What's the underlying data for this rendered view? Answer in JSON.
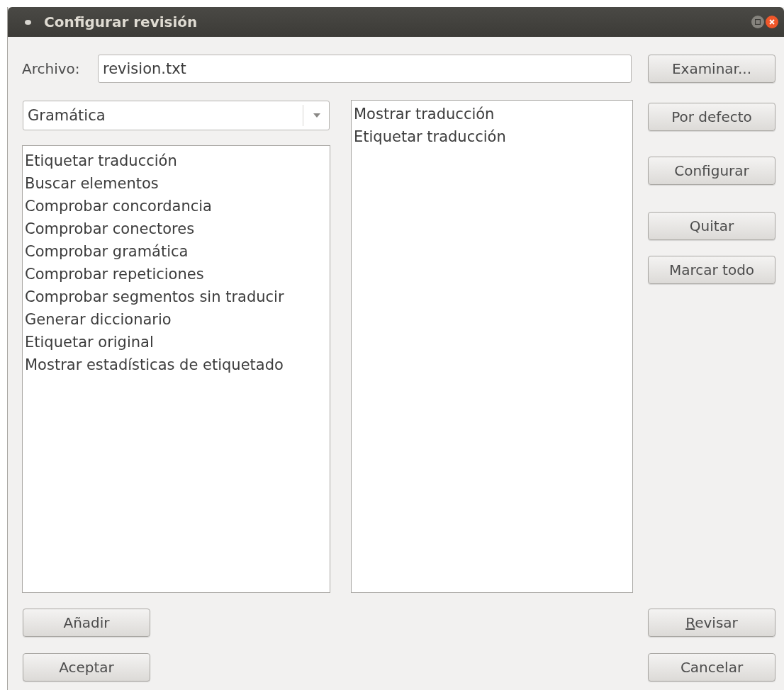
{
  "window": {
    "title": "Configurar revisión"
  },
  "file": {
    "label": "Archivo:",
    "value": "revision.txt",
    "button": "Examinar..."
  },
  "category": {
    "value": "Gramática"
  },
  "available": [
    "Etiquetar traducción",
    "Buscar elementos",
    "Comprobar concordancia",
    "Comprobar conectores",
    "Comprobar gramática",
    "Comprobar repeticiones",
    "Comprobar segmentos sin traducir",
    "Generar diccionario",
    "Etiquetar original",
    "Mostrar estadísticas de etiquetado"
  ],
  "selected_list": [
    "Mostrar traducción",
    "Etiquetar traducción"
  ],
  "side_buttons": [
    "Por defecto",
    "Configurar",
    "Quitar",
    "Marcar todo"
  ],
  "left_buttons": [
    {
      "label": "Añadir",
      "mnemonic": false
    },
    {
      "label": "Aceptar",
      "mnemonic": false
    }
  ],
  "right_buttons": [
    {
      "label": "Revisar",
      "mnemonic": true
    },
    {
      "label": "Cancelar",
      "mnemonic": false
    }
  ]
}
